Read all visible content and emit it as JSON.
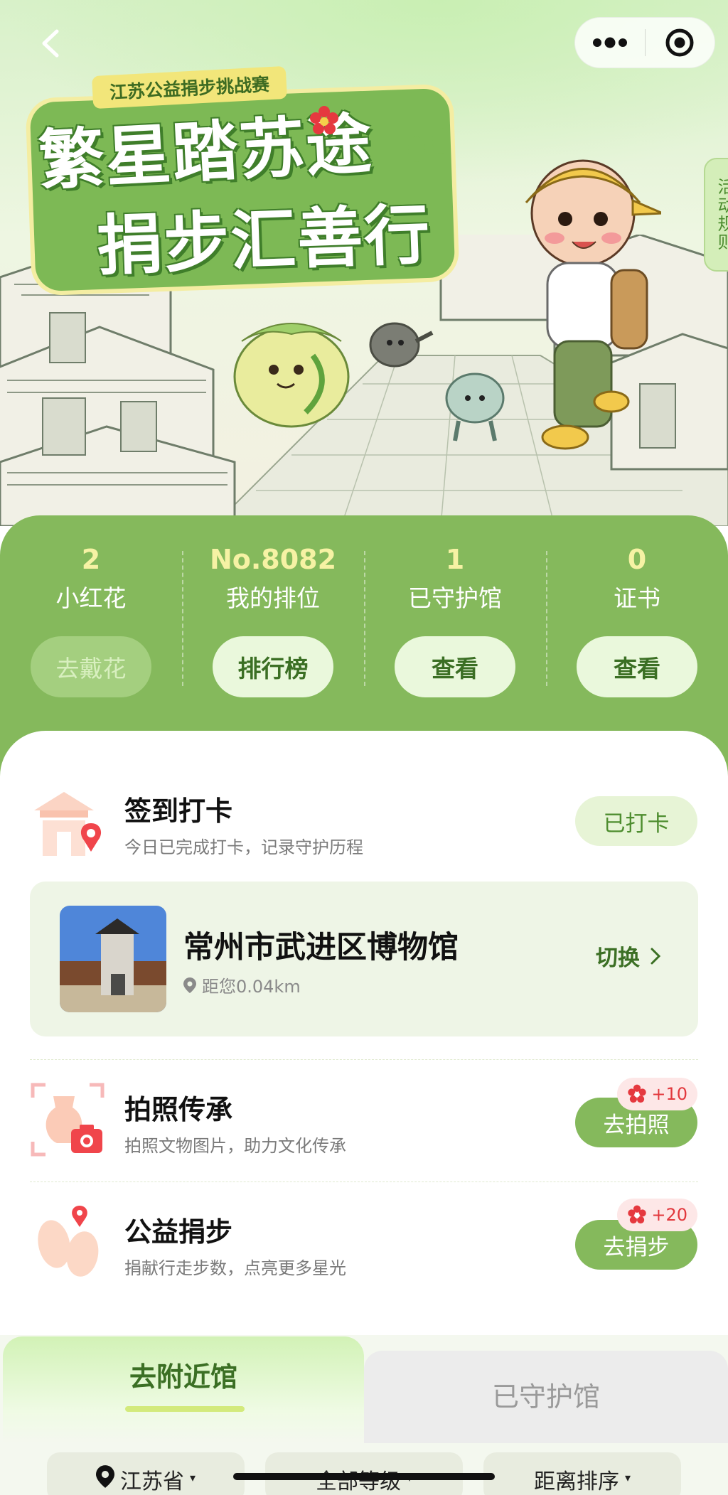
{
  "hero": {
    "tag": "江苏公益捐步挑战赛",
    "title_line1": "繁星踏苏途",
    "title_line2": "捐步汇善行",
    "rules_tab": "活动规则"
  },
  "stats": [
    {
      "value": "2",
      "label": "小红花",
      "button": "去戴花",
      "button_state": "disabled"
    },
    {
      "value": "No.8082",
      "label": "我的排位",
      "button": "排行榜",
      "button_state": "active"
    },
    {
      "value": "1",
      "label": "已守护馆",
      "button": "查看",
      "button_state": "active"
    },
    {
      "value": "0",
      "label": "证书",
      "button": "查看",
      "button_state": "active"
    }
  ],
  "checkin": {
    "title": "签到打卡",
    "desc": "今日已完成打卡，记录守护历程",
    "action": "已打卡"
  },
  "museum": {
    "name": "常州市武进区博物馆",
    "distance": "距您0.04km",
    "switch": "切换"
  },
  "photo_task": {
    "title": "拍照传承",
    "desc": "拍照文物图片，助力文化传承",
    "action": "去拍照",
    "reward": "+10"
  },
  "step_task": {
    "title": "公益捐步",
    "desc": "捐献行走步数，点亮更多星光",
    "action": "去捐步",
    "reward": "+20"
  },
  "tabs": [
    {
      "label": "去附近馆",
      "active": true
    },
    {
      "label": "已守护馆",
      "active": false
    }
  ],
  "filters": [
    {
      "label": "江苏省",
      "icon": "location-pin-icon"
    },
    {
      "label": "全部等级",
      "icon": ""
    },
    {
      "label": "距离排序",
      "icon": ""
    }
  ],
  "colors": {
    "brand_green": "#85b95c",
    "dark_green": "#3b6f24",
    "reward_red": "#e2383d"
  }
}
